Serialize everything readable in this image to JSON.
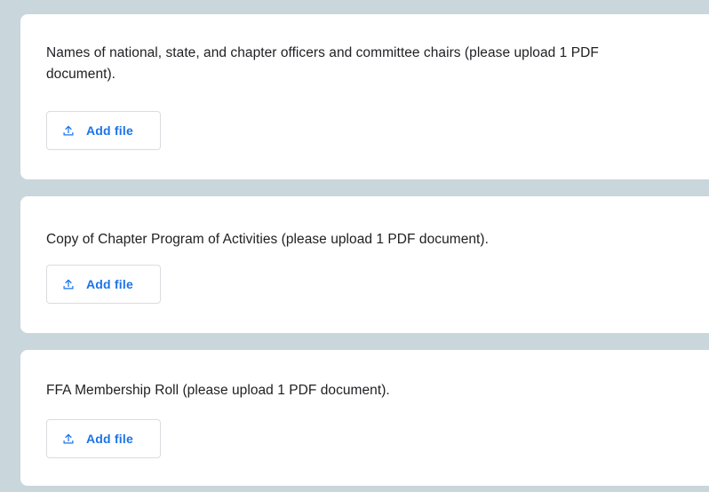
{
  "questions": [
    {
      "text": "Names of national, state, and chapter officers and committee chairs (please upload 1 PDF document).",
      "button_label": "Add file",
      "button_icon": "upload-icon"
    },
    {
      "text": "Copy of Chapter Program of Activities (please upload 1 PDF document).",
      "button_label": "Add file",
      "button_icon": "upload-icon"
    },
    {
      "text": "FFA Membership Roll (please upload 1 PDF document).",
      "button_label": "Add file",
      "button_icon": "upload-icon"
    }
  ],
  "colors": {
    "page_background": "#c9d6dc",
    "card_background": "#ffffff",
    "question_text": "#202124",
    "accent": "#1a73e8",
    "button_border": "#dadce0"
  }
}
